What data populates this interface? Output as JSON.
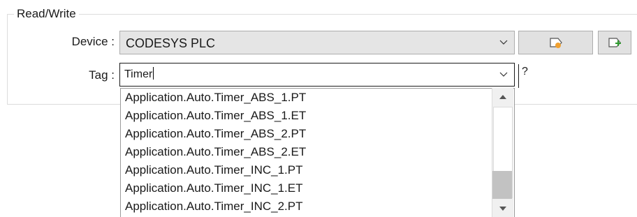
{
  "group": {
    "title": "Read/Write"
  },
  "device": {
    "label": "Device :",
    "value": "CODESYS PLC"
  },
  "tag": {
    "label": "Tag :",
    "value": "Timer",
    "help": "?"
  },
  "buttons": {
    "tag_button_icon": "tag-icon",
    "add_tag_button_icon": "tag-add-icon"
  },
  "dropdown": {
    "items": [
      "Application.Auto.Timer_ABS_1.PT",
      "Application.Auto.Timer_ABS_1.ET",
      "Application.Auto.Timer_ABS_2.PT",
      "Application.Auto.Timer_ABS_2.ET",
      "Application.Auto.Timer_INC_1.PT",
      "Application.Auto.Timer_INC_1.ET",
      "Application.Auto.Timer_INC_2.PT"
    ]
  },
  "colors": {
    "accent_orange": "#f0a030",
    "accent_green": "#2e9b2e"
  }
}
